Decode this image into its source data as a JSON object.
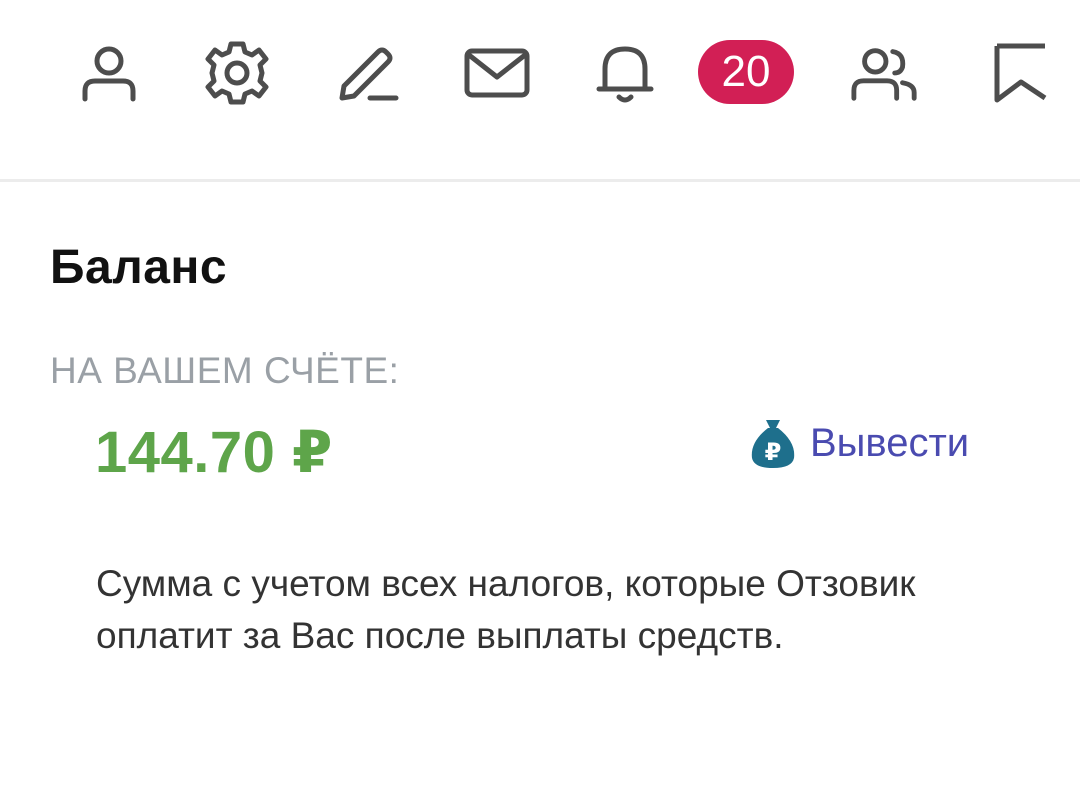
{
  "toolbar": {
    "icons": [
      "user-icon",
      "gear-icon",
      "pencil-icon",
      "mail-icon",
      "bell-icon",
      "friends-icon",
      "bookmark-icon"
    ],
    "notification_count": "20",
    "badge_color": "#d21f55",
    "icon_color": "#4d4d4d"
  },
  "balance": {
    "title": "Баланс",
    "account_label": "НА ВАШЕМ СЧЁТЕ:",
    "amount": "144.70 ₽",
    "amount_color": "#5ea54a",
    "withdraw_label": "Вывести",
    "withdraw_icon": "money-bag-icon",
    "withdraw_color": "#4a4bb0",
    "note": "Сумма с учетом всех налогов, которые Отзовик оплатит за Вас после выплаты средств."
  }
}
